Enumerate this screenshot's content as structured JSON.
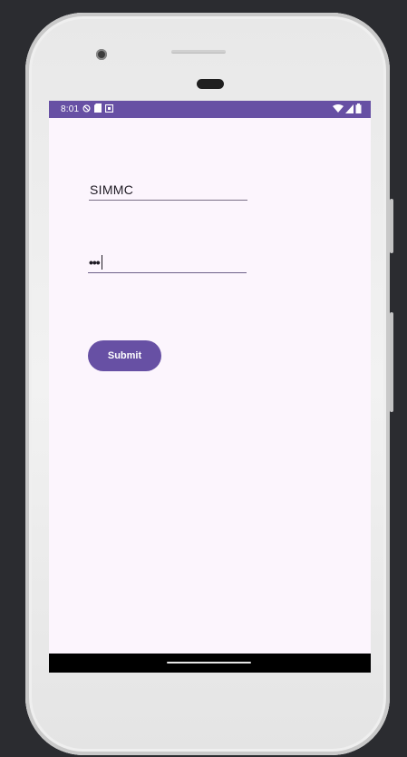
{
  "status_bar": {
    "time": "8:01",
    "left_icons": [
      "do-not-disturb-icon",
      "sim-card-icon",
      "notification-icon"
    ],
    "right_icons": [
      "wifi-icon",
      "signal-icon",
      "battery-icon"
    ],
    "color": "#6750a4"
  },
  "form": {
    "username_value": "SIMMC",
    "password_value": "•••",
    "submit_label": "Submit"
  },
  "colors": {
    "accent": "#6750a4",
    "background": "#fcf5fd"
  }
}
